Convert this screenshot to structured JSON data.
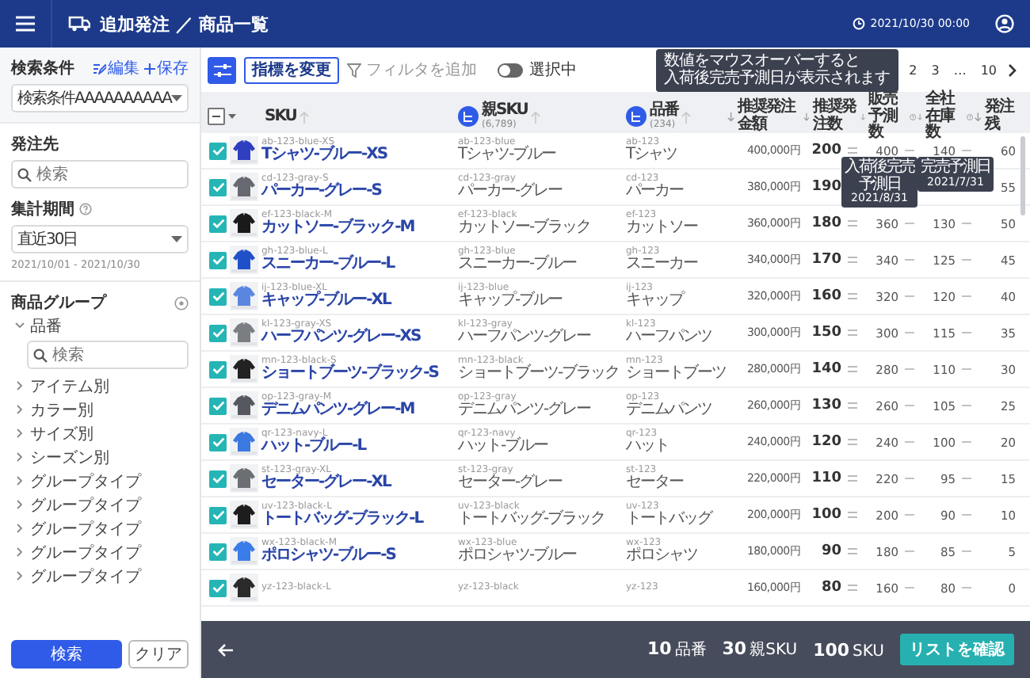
{
  "app_bar": {
    "title": "追加発注 ／ 商品一覧",
    "timestamp": "2021/10/30 00:00"
  },
  "sidebar": {
    "conditions": {
      "label": "検索条件",
      "actions": [
        {
          "label": "編集",
          "kind": "edit"
        },
        {
          "label": "保存",
          "kind": "save"
        }
      ],
      "value": "検索条件AAAAAAAAAA"
    },
    "supplier": {
      "label": "発注先",
      "placeholder": "検索"
    },
    "period": {
      "label": "集計期間",
      "value": "直近30日",
      "range": "2021/10/01 - 2021/10/30"
    },
    "product_group": {
      "title": "商品グループ",
      "children": [
        {
          "label": "品番",
          "expanded": true,
          "search_placeholder": "検索"
        },
        {
          "label": "アイテム別",
          "expanded": false
        },
        {
          "label": "カラー別",
          "expanded": false
        },
        {
          "label": "サイズ別",
          "expanded": false
        },
        {
          "label": "シーズン別",
          "expanded": false
        },
        {
          "label": "グループタイプ",
          "expanded": false
        },
        {
          "label": "グループタイプ",
          "expanded": false
        },
        {
          "label": "グループタイプ",
          "expanded": false
        },
        {
          "label": "グループタイプ",
          "expanded": false
        },
        {
          "label": "グループタイプ",
          "expanded": false
        }
      ]
    },
    "buttons": [
      {
        "label": "検索",
        "kind": "primary"
      },
      {
        "label": "クリア",
        "kind": "secondary"
      }
    ]
  },
  "toolbar": {
    "change_metrics": "指標を変更",
    "add_filter": "フィルタを追加",
    "selected_only": {
      "label": "選択中",
      "on": false
    },
    "pages": [
      "2",
      "3",
      "…",
      "10"
    ]
  },
  "hint_tooltip": {
    "line1": "数値をマウスオーバーすると",
    "line2": "入荷後完売予測日が表示されます"
  },
  "table": {
    "select_all": {
      "indeterminate": true
    },
    "columns": [
      {
        "label": "SKU"
      },
      {
        "label": "親SKU",
        "count": "(6,789)"
      },
      {
        "label": "品番",
        "count": "(234)"
      },
      {
        "label": "推奨発注金額"
      },
      {
        "label": "推奨発注数"
      },
      {
        "label": "販売予測数"
      },
      {
        "label": "全社在庫数"
      },
      {
        "label": "発注残"
      }
    ],
    "rows": [
      {
        "checked": true,
        "sku_code": "ab-123-blue-XS",
        "sku_name": "Tシャツ-ブルー-XS",
        "parent_code": "ab-123-blue",
        "parent_name": "Tシャツ-ブルー",
        "item_code": "ab-123",
        "item_name": "Tシャツ",
        "amount": "400,000円",
        "qty": "200",
        "forecast": "400",
        "stock": "140",
        "backorder": "60"
      },
      {
        "checked": true,
        "sku_code": "cd-123-gray-S",
        "sku_name": "パーカー-グレー-S",
        "parent_code": "cd-123-gray",
        "parent_name": "パーカー-グレー",
        "item_code": "cd-123",
        "item_name": "パーカー",
        "amount": "380,000円",
        "qty": "190",
        "forecast_tooltip": {
          "label": "入荷後完売予測日",
          "date": "2021/8/31"
        },
        "stock_tooltip": {
          "label": "完売予測日",
          "date": "2021/7/31"
        },
        "backorder": "55"
      },
      {
        "checked": true,
        "sku_code": "ef-123-black-M",
        "sku_name": "カットソー-ブラック-M",
        "parent_code": "ef-123-black",
        "parent_name": "カットソー-ブラック",
        "item_code": "ef-123",
        "item_name": "カットソー",
        "amount": "360,000円",
        "qty": "180",
        "forecast": "360",
        "stock": "130",
        "backorder": "50"
      },
      {
        "checked": true,
        "sku_code": "gh-123-blue-L",
        "sku_name": "スニーカー-ブルー-L",
        "parent_code": "gh-123-blue",
        "parent_name": "スニーカー-ブルー",
        "item_code": "gh-123",
        "item_name": "スニーカー",
        "amount": "340,000円",
        "qty": "170",
        "forecast": "340",
        "stock": "125",
        "backorder": "45"
      },
      {
        "checked": true,
        "sku_code": "ij-123-blue-XL",
        "sku_name": "キャップ-ブルー-XL",
        "parent_code": "ij-123-blue",
        "parent_name": "キャップ-ブルー",
        "item_code": "ij-123",
        "item_name": "キャップ",
        "amount": "320,000円",
        "qty": "160",
        "forecast": "320",
        "stock": "120",
        "backorder": "40"
      },
      {
        "checked": true,
        "sku_code": "kl-123-gray-XS",
        "sku_name": "ハーフパンツ-グレー-XS",
        "parent_code": "kl-123-gray",
        "parent_name": "ハーフパンツ-グレー",
        "item_code": "kl-123",
        "item_name": "ハーフパンツ",
        "amount": "300,000円",
        "qty": "150",
        "forecast": "300",
        "stock": "115",
        "backorder": "35"
      },
      {
        "checked": true,
        "sku_code": "mn-123-black-S",
        "sku_name": "ショートブーツ-ブラック-S",
        "parent_code": "mn-123-black",
        "parent_name": "ショートブーツ-ブラック",
        "item_code": "mn-123",
        "item_name": "ショートブーツ",
        "amount": "280,000円",
        "qty": "140",
        "forecast": "280",
        "stock": "110",
        "backorder": "30"
      },
      {
        "checked": true,
        "sku_code": "op-123-gray-M",
        "sku_name": "デニムパンツ-グレー-M",
        "parent_code": "op-123-gray",
        "parent_name": "デニムパンツ-グレー",
        "item_code": "op-123",
        "item_name": "デニムパンツ",
        "amount": "260,000円",
        "qty": "130",
        "forecast": "260",
        "stock": "105",
        "backorder": "25"
      },
      {
        "checked": true,
        "sku_code": "qr-123-navy-L",
        "sku_name": "ハット-ブルー-L",
        "parent_code": "qr-123-navy",
        "parent_name": "ハット-ブルー",
        "item_code": "qr-123",
        "item_name": "ハット",
        "amount": "240,000円",
        "qty": "120",
        "forecast": "240",
        "stock": "100",
        "backorder": "20"
      },
      {
        "checked": true,
        "sku_code": "st-123-gray-XL",
        "sku_name": "セーター-グレー-XL",
        "parent_code": "st-123-gray",
        "parent_name": "セーター-グレー",
        "item_code": "st-123",
        "item_name": "セーター",
        "amount": "220,000円",
        "qty": "110",
        "forecast": "220",
        "stock": "95",
        "backorder": "15"
      },
      {
        "checked": true,
        "sku_code": "uv-123-black-L",
        "sku_name": "トートバッグ-ブラック-L",
        "parent_code": "uv-123-black",
        "parent_name": "トートバッグ-ブラック",
        "item_code": "uv-123",
        "item_name": "トートバッグ",
        "amount": "200,000円",
        "qty": "100",
        "forecast": "200",
        "stock": "90",
        "backorder": "10"
      },
      {
        "checked": true,
        "sku_code": "wx-123-black-M",
        "sku_name": "ポロシャツ-ブルー-S",
        "parent_code": "wx-123-blue",
        "parent_name": "ポロシャツ-ブルー",
        "item_code": "wx-123",
        "item_name": "ポロシャツ",
        "amount": "180,000円",
        "qty": "90",
        "forecast": "180",
        "stock": "85",
        "backorder": "5"
      },
      {
        "checked": true,
        "sku_code": "yz-123-black-L",
        "parent_code": "yz-123-black",
        "item_code": "yz-123",
        "amount": "160,000円",
        "qty": "80",
        "forecast": "160",
        "stock": "80",
        "backorder": "0"
      }
    ]
  },
  "footer": {
    "totals": [
      {
        "count": "10",
        "unit": "品番"
      },
      {
        "count": "30",
        "unit": "親SKU"
      },
      {
        "count": "100",
        "unit": "SKU"
      }
    ],
    "confirm": "リストを確認"
  }
}
